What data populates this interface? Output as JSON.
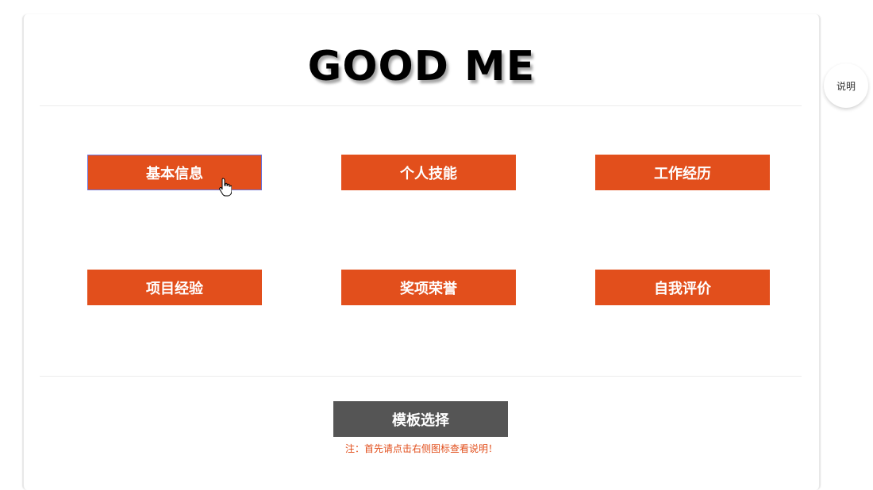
{
  "header": {
    "title": "GOOD ME"
  },
  "nav": {
    "buttons": [
      {
        "label": "基本信息"
      },
      {
        "label": "个人技能"
      },
      {
        "label": "工作经历"
      },
      {
        "label": "项目经验"
      },
      {
        "label": "奖项荣誉"
      },
      {
        "label": "自我评价"
      }
    ]
  },
  "footer": {
    "template_button": "模板选择",
    "note": "注：首先请点击右侧图标查看说明！"
  },
  "help": {
    "label": "说明"
  },
  "colors": {
    "accent": "#e24f1c",
    "template_button": "#555555",
    "focus_border": "#6b72d8"
  },
  "icons": {
    "cursor": "hand-pointer-icon"
  }
}
